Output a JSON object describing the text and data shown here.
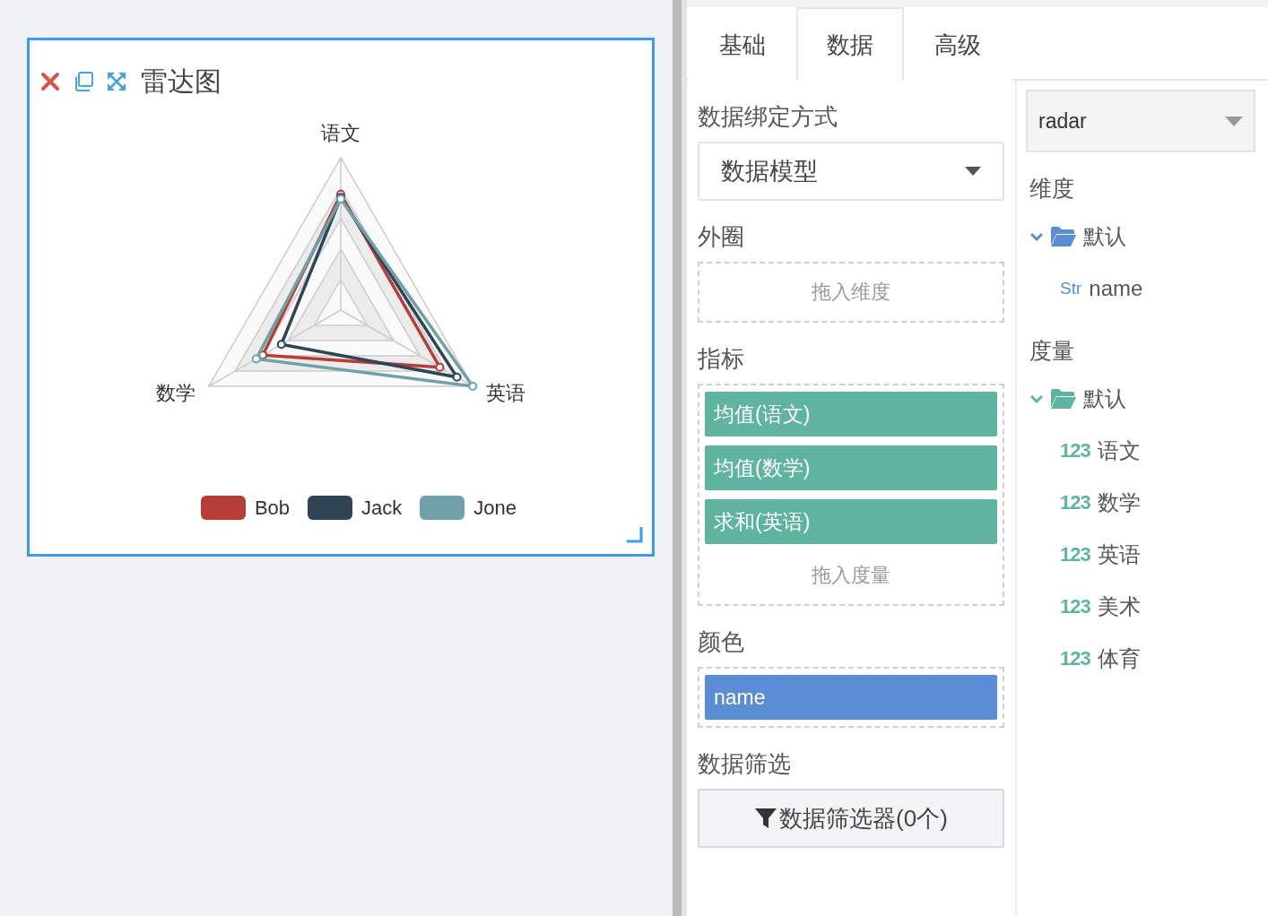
{
  "chart_card": {
    "title": "雷达图",
    "axes": [
      "语文",
      "数学",
      "英语"
    ],
    "legend": [
      {
        "name": "Bob",
        "color": "#b83d36"
      },
      {
        "name": "Jack",
        "color": "#2f4454"
      },
      {
        "name": "Jone",
        "color": "#6fa2a8"
      }
    ]
  },
  "tabs": [
    {
      "label": "基础",
      "selected": false
    },
    {
      "label": "数据",
      "selected": true
    },
    {
      "label": "高级",
      "selected": false
    }
  ],
  "binding": {
    "label": "数据绑定方式",
    "value": "数据模型"
  },
  "zones": [
    {
      "label": "外圈",
      "drop_hint": "拖入维度"
    },
    {
      "label": "指标",
      "chips": [
        {
          "text": "均值(语文)",
          "kind": "measure"
        },
        {
          "text": "均值(数学)",
          "kind": "measure"
        },
        {
          "text": "求和(英语)",
          "kind": "measure"
        }
      ],
      "drop_hint": "拖入度量"
    },
    {
      "label": "颜色",
      "chips": [
        {
          "text": "name",
          "kind": "dimension"
        }
      ]
    }
  ],
  "filter": {
    "label": "数据筛选",
    "button": "数据筛选器(0个)"
  },
  "model_select": "radar",
  "fields": [
    {
      "heading": "维度",
      "groups": [
        {
          "name": "默认",
          "kind": "dimension",
          "expanded": true,
          "children": [
            {
              "type": "Str",
              "name": "name",
              "kind": "dimension"
            }
          ]
        }
      ]
    },
    {
      "heading": "度量",
      "groups": [
        {
          "name": "默认",
          "kind": "measure",
          "expanded": true,
          "children": [
            {
              "type": "123",
              "name": "语文",
              "kind": "measure"
            },
            {
              "type": "123",
              "name": "数学",
              "kind": "measure"
            },
            {
              "type": "123",
              "name": "英语",
              "kind": "measure"
            },
            {
              "type": "123",
              "name": "美术",
              "kind": "measure"
            },
            {
              "type": "123",
              "name": "体育",
              "kind": "measure"
            }
          ]
        }
      ]
    }
  ]
}
